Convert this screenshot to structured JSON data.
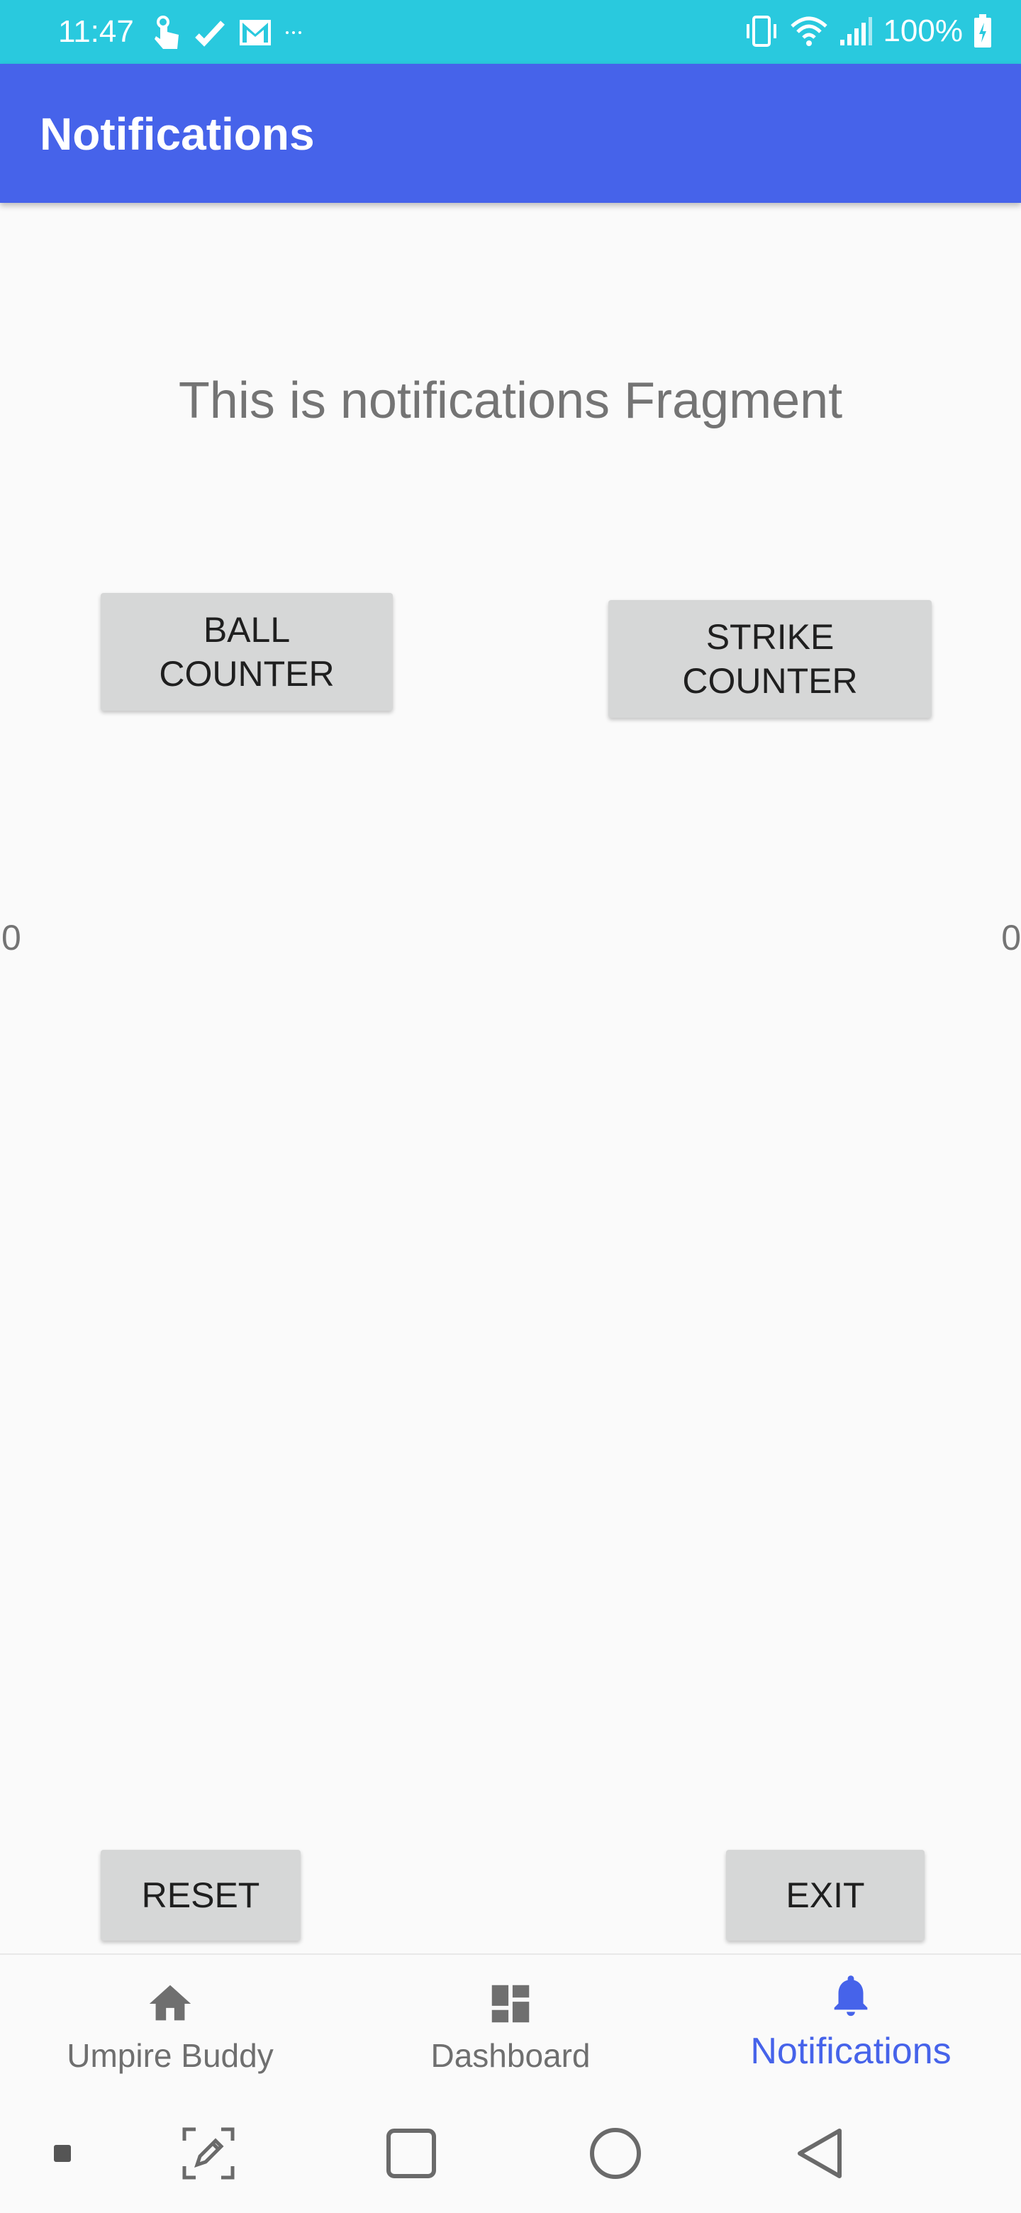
{
  "status_bar": {
    "time": "11:47",
    "battery": "100%",
    "icons_left": [
      "touch-icon",
      "check-icon",
      "gmail-icon",
      "more-dots-icon"
    ],
    "icons_right": [
      "vibrate-icon",
      "wifi-icon",
      "signal-icon",
      "battery-icon"
    ]
  },
  "app_bar": {
    "title": "Notifications"
  },
  "main": {
    "fragment_text": "This is notifications Fragment",
    "ball_button": {
      "line1": "BALL",
      "line2": "COUNTER"
    },
    "strike_button": {
      "line1": "STRIKE",
      "line2": "COUNTER"
    },
    "ball_count": "0",
    "strike_count": "0",
    "reset_label": "RESET",
    "exit_label": "EXIT"
  },
  "bottom_nav": {
    "items": [
      {
        "label": "Umpire Buddy",
        "icon": "home-icon",
        "selected": false
      },
      {
        "label": "Dashboard",
        "icon": "dashboard-icon",
        "selected": false
      },
      {
        "label": "Notifications",
        "icon": "bell-icon",
        "selected": true
      }
    ]
  },
  "system_nav": [
    "dot-icon",
    "screenshot-edit-icon",
    "recents-icon",
    "home-circle-icon",
    "back-icon"
  ],
  "colors": {
    "status_bar": "#29c9de",
    "app_bar": "#4663ea",
    "accent": "#4663ea",
    "button": "#d6d7d7",
    "background": "#fafafa"
  }
}
